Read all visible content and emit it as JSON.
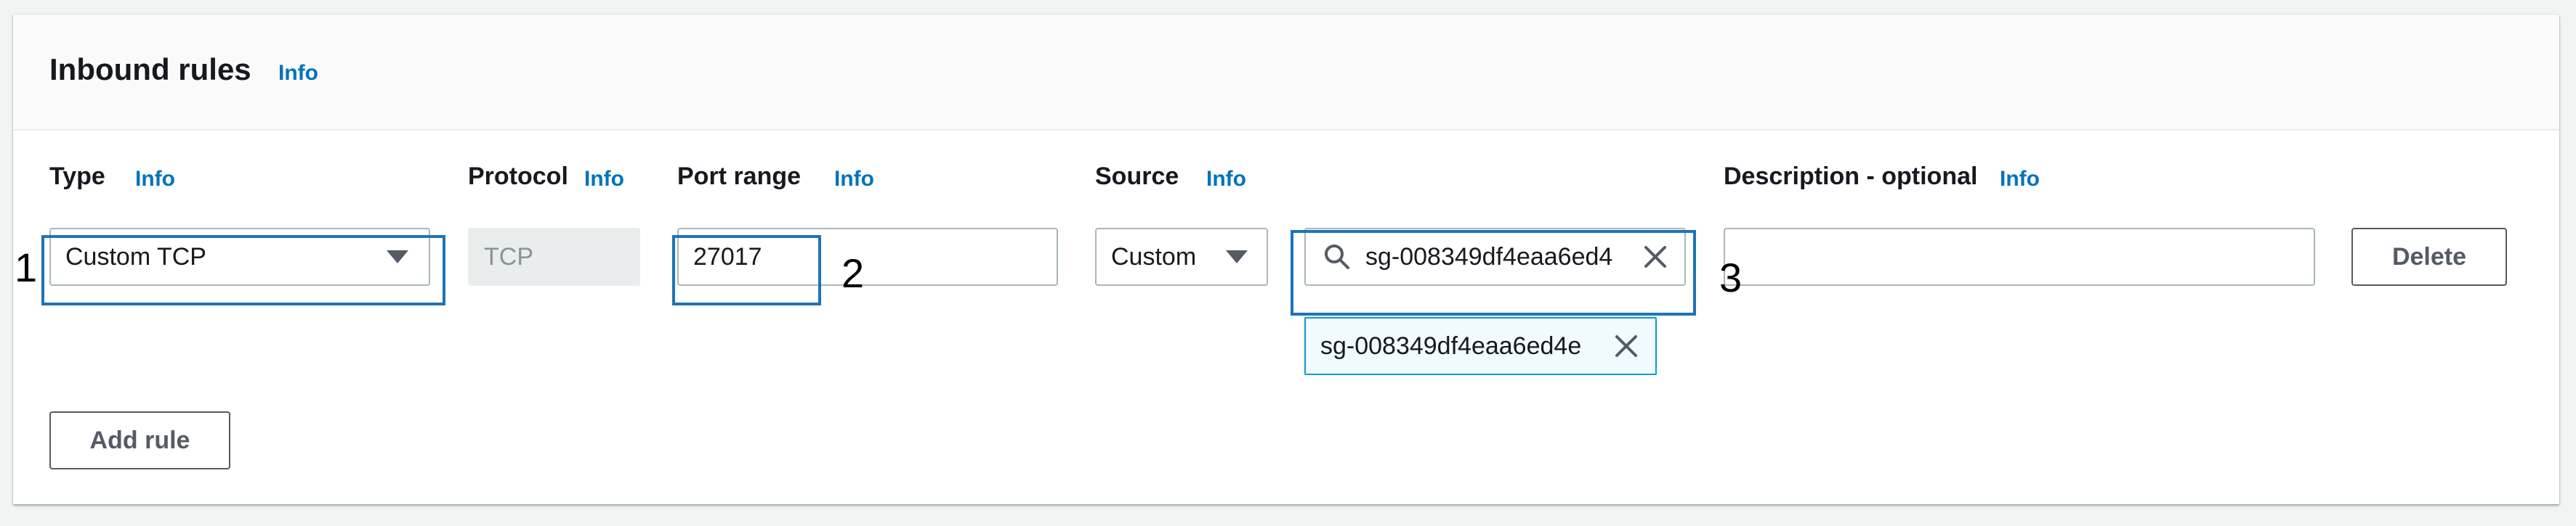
{
  "header": {
    "title": "Inbound rules",
    "info_label": "Info"
  },
  "columns": {
    "type": "Type",
    "protocol": "Protocol",
    "port_range": "Port range",
    "source": "Source",
    "description": "Description - optional",
    "info_label": "Info"
  },
  "rule": {
    "type_value": "Custom TCP",
    "protocol_value": "TCP",
    "port_range_value": "27017",
    "source_type_value": "Custom",
    "source_search_value": "sg-008349df4eaa6ed4",
    "source_token": "sg-008349df4eaa6ed4e",
    "description_value": ""
  },
  "buttons": {
    "delete": "Delete",
    "add_rule": "Add rule"
  },
  "markers": {
    "m1": "1",
    "m2": "2",
    "m3": "3"
  },
  "colors": {
    "link": "#0073bb",
    "highlight": "#1f73b7",
    "token_bg": "#f1faff",
    "token_border": "#00a1c9"
  },
  "icons": {
    "type_dropdown": "caret-down-icon",
    "source_dropdown": "caret-down-icon",
    "search": "search-icon",
    "clear": "close-icon",
    "token_remove": "close-icon"
  }
}
